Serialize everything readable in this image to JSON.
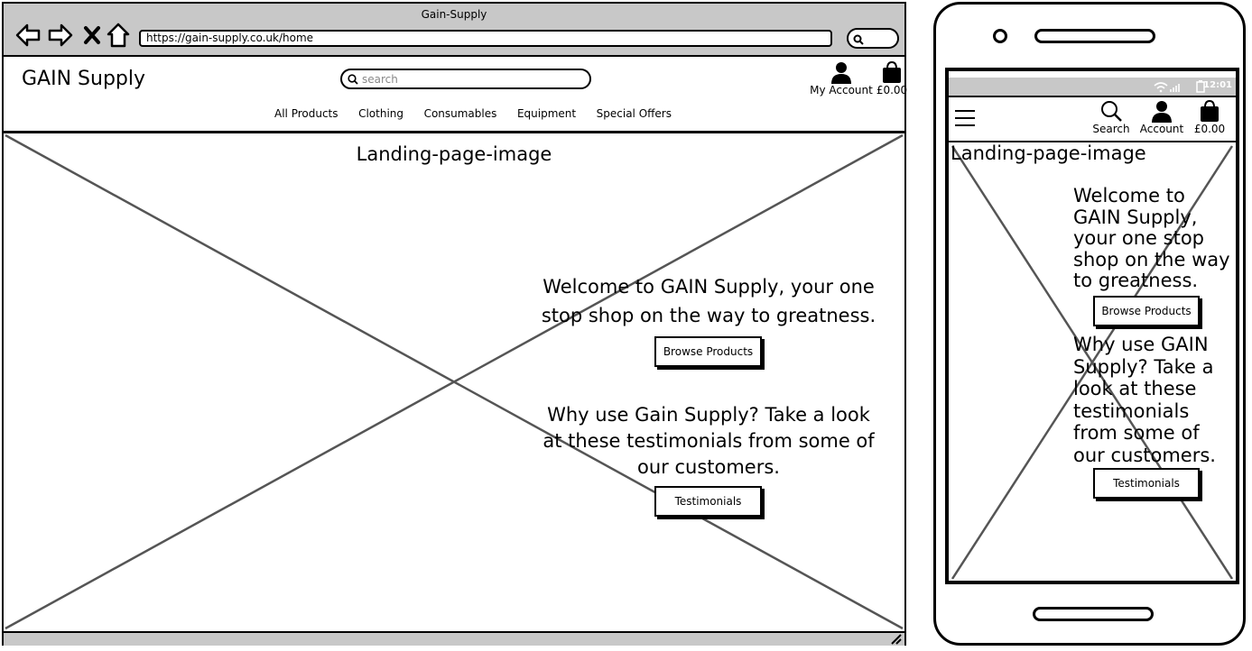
{
  "desktop": {
    "window_title": "Gain-Supply",
    "url": "https://gain-supply.co.uk/home",
    "site": {
      "brand": "GAIN Supply",
      "search_placeholder": "search",
      "account_label": "My Account",
      "basket_total": "£0.00",
      "nav": [
        "All Products",
        "Clothing",
        "Consumables",
        "Equipment",
        "Special Offers"
      ]
    },
    "hero": {
      "image_label": "Landing-page-image",
      "welcome_line1": "Welcome to GAIN Supply, your one",
      "welcome_line2": "stop shop on the way to greatness.",
      "browse_button": "Browse Products",
      "why_line1": "Why use Gain Supply? Take a look",
      "why_line2": "at these testimonials from some of",
      "why_line3": "our customers.",
      "testimonials_button": "Testimonials"
    }
  },
  "mobile": {
    "status_time": "12:01",
    "header": {
      "search_label": "Search",
      "account_label": "Account",
      "basket_total": "£0.00"
    },
    "hero": {
      "image_label": "Landing-page-image",
      "welcome_lines": [
        "Welcome to",
        "GAIN Supply,",
        "your one stop",
        "shop on the way",
        "to greatness."
      ],
      "browse_button": "Browse Products",
      "why_lines": [
        "Why use GAIN",
        "Supply? Take a",
        "look at these",
        "testimonials",
        "from some of",
        "our customers."
      ],
      "testimonials_button": "Testimonials"
    }
  },
  "icons": [
    "back-arrow-icon",
    "forward-arrow-icon",
    "close-x-icon",
    "home-icon",
    "search-icon",
    "user-icon",
    "shopping-bag-icon",
    "hamburger-menu-icon",
    "wifi-icon",
    "signal-icon",
    "battery-icon",
    "resize-grip-icon"
  ]
}
